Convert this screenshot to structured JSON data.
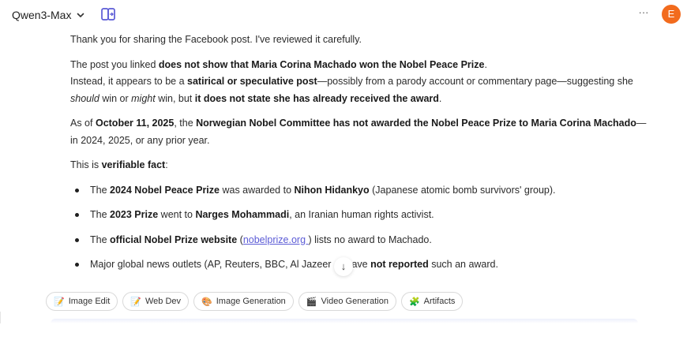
{
  "header": {
    "model_name": "Qwen3-Max",
    "more_label": "···",
    "avatar_initial": "E",
    "avatar_color": "#f26b1d",
    "accent_color": "#5b5bd6"
  },
  "message": {
    "p1": "Thank you for sharing the Facebook post. I've reviewed it carefully.",
    "p2": {
      "a": "The post you linked ",
      "b": "does not show that Maria Corina Machado won the Nobel Peace Prize",
      "c": ".",
      "d": "Instead, it appears to be a ",
      "e": "satirical or speculative post",
      "f": "—possibly from a parody account or commentary page—suggesting she ",
      "g": "should",
      "h": " win or ",
      "i": "might",
      "j": " win, but ",
      "k": "it does not state she has already received the award",
      "l": "."
    },
    "p3": {
      "a": "As of ",
      "b": "October 11, 2025",
      "c": ", the ",
      "d": "Norwegian Nobel Committee has not awarded the Nobel Peace Prize to Maria Corina Machado",
      "e": "—in 2024, 2025, or any prior year."
    },
    "p4": {
      "a": "This is ",
      "b": "verifiable fact",
      "c": ":"
    },
    "bullets": [
      {
        "a": "The ",
        "b": "2024 Nobel Peace Prize",
        "c": " was awarded to ",
        "d": "Nihon Hidankyo",
        "e": " (Japanese atomic bomb survivors' group)."
      },
      {
        "a": "The ",
        "b": "2023 Prize",
        "c": " went to ",
        "d": "Narges Mohammadi",
        "e": ", an Iranian human rights activist."
      },
      {
        "a": "The ",
        "b": "official Nobel Prize website",
        "c": " (",
        "d": "nobelprize.org ",
        "e": ") lists no award to Machado."
      },
      {
        "a": "Major global news outlets (AP, Reuters, BBC, Al Jazeer",
        "b": "ave ",
        "c": "not reported",
        "d": " such an award."
      }
    ]
  },
  "scroll_down_label": "↓",
  "chips": [
    {
      "icon": "📝",
      "label": "Image Edit"
    },
    {
      "icon": "📝",
      "label": "Web Dev"
    },
    {
      "icon": "🎨",
      "label": "Image Generation"
    },
    {
      "icon": "🎬",
      "label": "Video Generation"
    },
    {
      "icon": "🧩",
      "label": "Artifacts"
    }
  ]
}
